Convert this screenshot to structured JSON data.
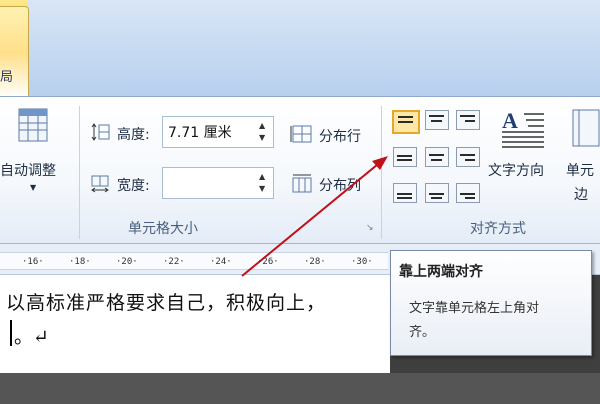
{
  "tab": {
    "active_label": "局"
  },
  "cell_size": {
    "autofit_label": "自动调整",
    "height_label": "高度:",
    "height_value": "7.71 厘米",
    "width_label": "宽度:",
    "width_value": "",
    "distribute_rows": "分布行",
    "distribute_cols": "分布列",
    "group_label": "单元格大小"
  },
  "alignment": {
    "text_direction_label": "文字方向",
    "cell_margin_label_1": "单元",
    "cell_margin_label_2": "边",
    "group_label": "对齐方式"
  },
  "ruler": {
    "ticks": [
      "16",
      "18",
      "20",
      "22",
      "24",
      "26",
      "28",
      "30"
    ]
  },
  "document": {
    "line1": "以高标准严格要求自己，积极向上，",
    "line2": "。↵"
  },
  "tooltip": {
    "title": "靠上两端对齐",
    "body_line1": "文字靠单元格左上角对",
    "body_line2": "齐。"
  },
  "colors": {
    "accent": "#c0101a",
    "selected_button": "#ffe7a6",
    "ribbon_blue": "#c5d9f1"
  }
}
